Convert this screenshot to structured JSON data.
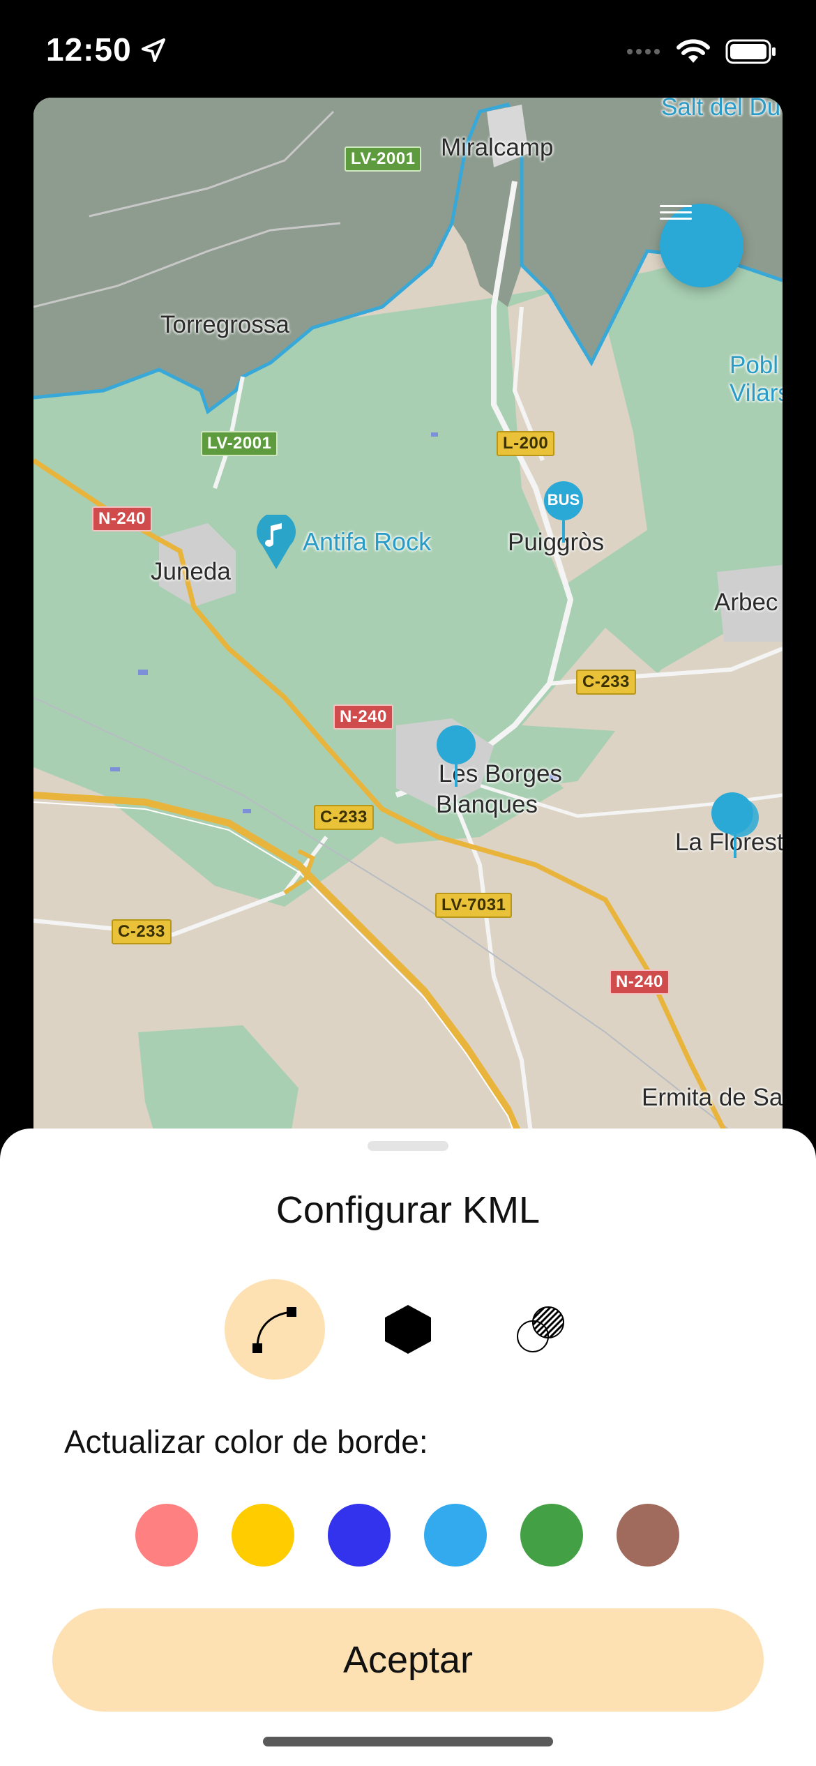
{
  "status_bar": {
    "time": "12:50"
  },
  "map": {
    "places": [
      "Miralcamp",
      "Torregrossa",
      "Juneda",
      "Puiggròs",
      "Arbec",
      "Les Borges\nBlanques",
      "La Florest",
      "Ermita de Sa"
    ],
    "water_labels": [
      "Salt del Du",
      "Pobl\nVilars"
    ],
    "poi": "Antifa Rock",
    "roads": {
      "lv2001_a": "LV-2001",
      "lv2001_b": "LV-2001",
      "l200": "L-200",
      "n240_a": "N-240",
      "n240_b": "N-240",
      "n240_c": "N-240",
      "c233_a": "C-233",
      "c233_b": "C-233",
      "c233_c": "C-233",
      "lv7031": "LV-7031"
    },
    "bus_marker_label": "BUS",
    "colors": {
      "green_area": "#a8cfb2",
      "beige": "#dcd3c4",
      "dark_zone": "#8e9c8f",
      "boundary": "#38a8d8",
      "highway": "#e9b43c"
    }
  },
  "sheet": {
    "title": "Configurar KML",
    "modes": [
      {
        "name": "line-mode",
        "icon": "bezier-curve-icon",
        "active": true
      },
      {
        "name": "polygon-mode",
        "icon": "hexagon-icon",
        "active": false
      },
      {
        "name": "intersection-mode",
        "icon": "overlap-circles-icon",
        "active": false
      }
    ],
    "border_color_label": "Actualizar color de borde:",
    "colors": [
      "#ff8080",
      "#ffcc00",
      "#3333ee",
      "#33aaee",
      "#44a044",
      "#a06a5c"
    ],
    "accept_label": "Aceptar"
  }
}
